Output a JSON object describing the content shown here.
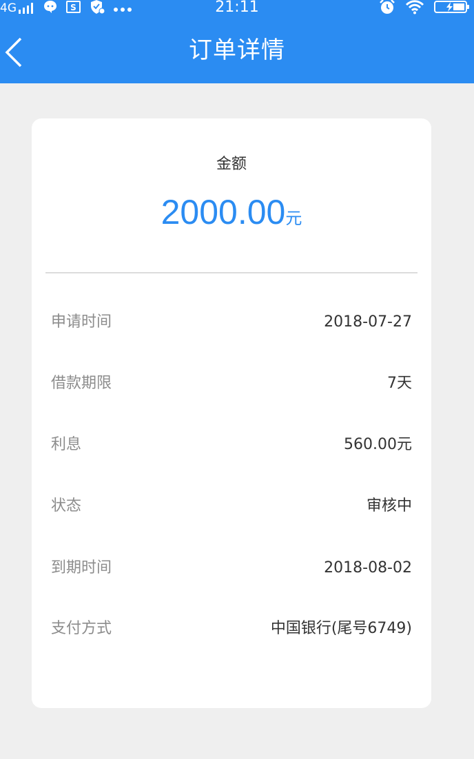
{
  "status_bar": {
    "network": "4G",
    "time": "21:11"
  },
  "header": {
    "title": "订单详情"
  },
  "amount": {
    "label": "金额",
    "value": "2000.00",
    "unit": "元"
  },
  "details": [
    {
      "label": "申请时间",
      "value": "2018-07-27"
    },
    {
      "label": "借款期限",
      "value": "7天"
    },
    {
      "label": "利息",
      "value": "560.00元"
    },
    {
      "label": "状态",
      "value": "审核中"
    },
    {
      "label": "到期时间",
      "value": "2018-08-02"
    },
    {
      "label": "支付方式",
      "value": "中国银行(尾号6749)"
    }
  ],
  "colors": {
    "accent": "#2b8cf2",
    "background": "#efefef",
    "card": "#ffffff",
    "label_text": "#8c8c8c",
    "value_text": "#333333"
  },
  "icons": {
    "status_left": [
      "signal-icon",
      "chat-icon",
      "sim-icon",
      "shield-icon",
      "more-dots-icon"
    ],
    "status_right": [
      "alarm-icon",
      "wifi-icon",
      "battery-icon"
    ],
    "header": "back-arrow-icon"
  }
}
